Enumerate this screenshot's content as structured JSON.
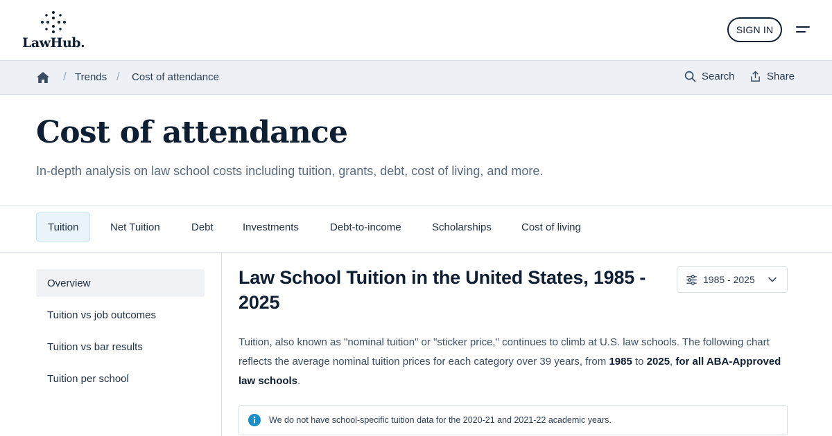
{
  "header": {
    "logo_text": "LawHub.",
    "signin_label": "SIGN IN",
    "menu_icon": "menu-icon"
  },
  "breadcrumb": {
    "home_icon": "home-icon",
    "items": [
      "Trends",
      "Cost of attendance"
    ],
    "separator": "/",
    "actions": {
      "search_label": "Search",
      "share_label": "Share"
    }
  },
  "page": {
    "title": "Cost of attendance",
    "subtitle": "In-depth analysis on law school costs including tuition, grants, debt, cost of living, and more."
  },
  "tabs": [
    {
      "label": "Tuition",
      "active": true
    },
    {
      "label": "Net Tuition",
      "active": false
    },
    {
      "label": "Debt",
      "active": false
    },
    {
      "label": "Investments",
      "active": false
    },
    {
      "label": "Debt-to-income",
      "active": false
    },
    {
      "label": "Scholarships",
      "active": false
    },
    {
      "label": "Cost of living",
      "active": false
    }
  ],
  "sidebar": {
    "items": [
      {
        "label": "Overview",
        "active": true
      },
      {
        "label": "Tuition vs job outcomes",
        "active": false
      },
      {
        "label": "Tuition vs bar results",
        "active": false
      },
      {
        "label": "Tuition per school",
        "active": false
      }
    ]
  },
  "main": {
    "title": "Law School Tuition in the United States, 1985 - 2025",
    "range_select": {
      "value": "1985 - 2025"
    },
    "paragraph": {
      "part1": "Tuition, also known as \"nominal tuition\" or \"sticker price,\" continues to climb at U.S. law schools. The following chart reflects the average nominal tuition prices for each category over 39 years, from ",
      "start_year": "1985",
      "to_text": " to ",
      "end_year": "2025",
      "comma": ", ",
      "scope": "for all ABA-Approved law schools",
      "end": "."
    },
    "notice": "We do not have school-specific tuition data for the 2020-21 and 2021-22 academic years."
  },
  "colors": {
    "navy": "#0f1f33",
    "crumb_bg": "#edf1f6",
    "tab_active_bg": "#e9f4fa",
    "info_blue": "#1a8fc9"
  }
}
